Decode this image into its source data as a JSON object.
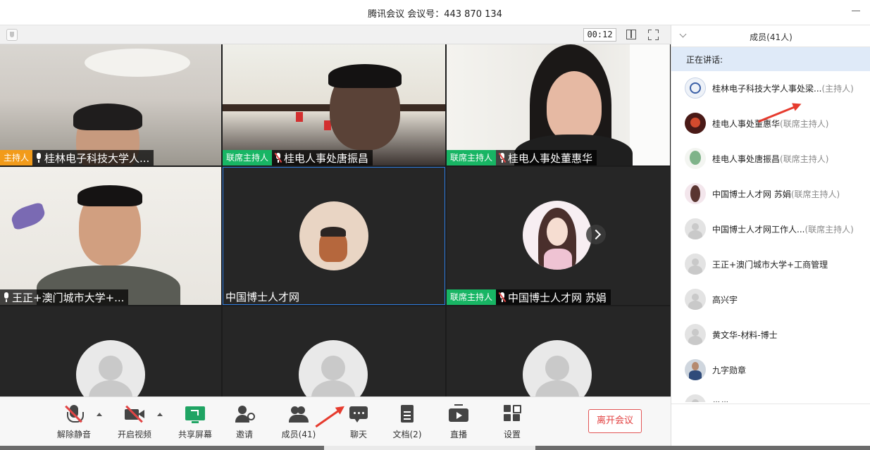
{
  "window": {
    "title": "腾讯会议  会议号：443 870 134"
  },
  "video_top": {
    "timer": "00:12"
  },
  "tiles": [
    {
      "role": "主持人",
      "role_type": "host",
      "name": "桂林电子科技大学人..."
    },
    {
      "role": "联席主持人",
      "role_type": "cohost",
      "name": "桂电人事处唐振昌"
    },
    {
      "role": "联席主持人",
      "role_type": "cohost",
      "name": "桂电人事处董惠华"
    },
    {
      "role": "",
      "role_type": "none",
      "name": "王正+澳门城市大学+..."
    },
    {
      "role": "",
      "role_type": "none",
      "name": "中国博士人才网"
    },
    {
      "role": "联席主持人",
      "role_type": "cohost",
      "name": "中国博士人才网 苏娟"
    }
  ],
  "toolbar": {
    "unmute": "解除静音",
    "start_video": "开启视频",
    "share_screen": "共享屏幕",
    "invite": "邀请",
    "members": "成员(41)",
    "chat": "聊天",
    "docs": "文档(2)",
    "live": "直播",
    "settings": "设置",
    "leave": "离开会议"
  },
  "panel": {
    "title": "成员(41人)",
    "speaking_label": "正在讲话:",
    "members": [
      {
        "name": "桂林电子科技大学人事处梁...",
        "role": "(主持人)"
      },
      {
        "name": "桂电人事处董惠华",
        "role": "(联席主持人)"
      },
      {
        "name": "桂电人事处唐振昌",
        "role": "(联席主持人)"
      },
      {
        "name": "中国博士人才网 苏娟",
        "role": "(联席主持人)"
      },
      {
        "name": "中国博士人才网工作人...",
        "role": "(联席主持人)"
      },
      {
        "name": "王正+澳门城市大学+工商管理",
        "role": ""
      },
      {
        "name": "高兴宇",
        "role": ""
      },
      {
        "name": "黄文华-材料-博士",
        "role": ""
      },
      {
        "name": "九字勋章",
        "role": ""
      },
      {
        "name": "常常",
        "role": ""
      }
    ]
  },
  "colors": {
    "host_badge": "#f29b1a",
    "cohost_badge": "#18b564",
    "leave_button": "#e24040",
    "annotation_arrow": "#e63b2e",
    "speaking_bg": "#dfeaf8"
  }
}
